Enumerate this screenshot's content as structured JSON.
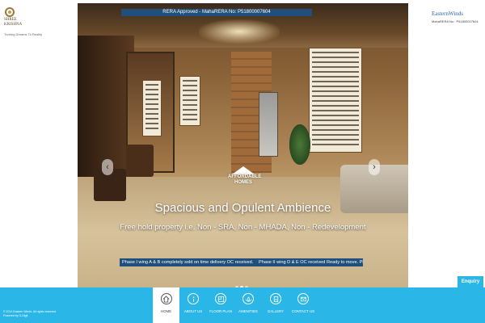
{
  "brand_left": {
    "name_line1": "SHREE",
    "name_line2": "KRISHNA",
    "tagline": "Turning Dreams To Reality"
  },
  "brand_right": {
    "name": "EasternWinds",
    "rera": "MahaRERA No : P51800007604"
  },
  "hero": {
    "rera_banner": "RERA Approved - MahaRERA No:  P51800007604",
    "badge_line1": "AFFORDABLE",
    "badge_line2": "HOMES",
    "headline": "Spacious and Opulent Ambience",
    "subline": "Free hold property i.e. Non - SRA, Non - MHADA, Non - Redevelopment",
    "ticker": [
      "Phase I wing A & B completely sold on time delivery OC received.",
      "Phase II wing D & E OC received Ready to move.  Ph"
    ],
    "prev_icon": "chevron-left-icon",
    "next_icon": "chevron-right-icon",
    "slide_count": 3,
    "active_slide": 1
  },
  "footer": {
    "copyright": "© 2014 Eastern Winds. All rights reserved.",
    "powered": "Powered by G-Digit",
    "enquiry_label": "Enquiry",
    "accent_color": "#2ab6e6",
    "nav": [
      {
        "label": "HOME",
        "icon": "home-icon",
        "active": true
      },
      {
        "label": "ABOUT US",
        "icon": "info-icon",
        "active": false
      },
      {
        "label": "FLOOR PLAN",
        "icon": "floor-plan-icon",
        "active": false
      },
      {
        "label": "AMENITIES",
        "icon": "lotus-icon",
        "active": false
      },
      {
        "label": "GALLERY",
        "icon": "gallery-icon",
        "active": false
      },
      {
        "label": "CONTACT US",
        "icon": "mail-icon",
        "active": false
      }
    ]
  }
}
